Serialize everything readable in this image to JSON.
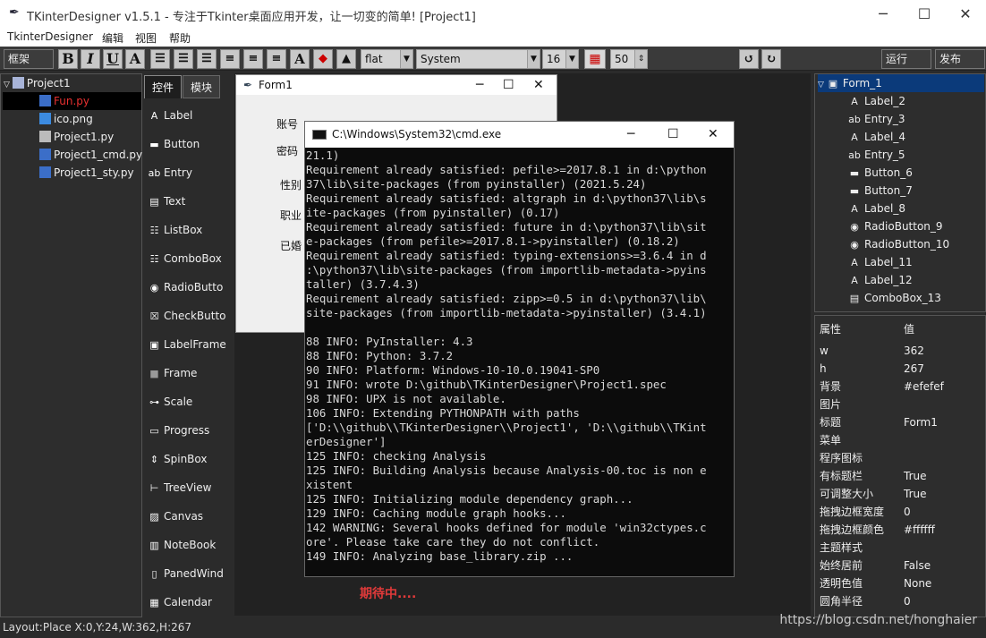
{
  "window": {
    "title": "TKinterDesigner v1.5.1 - 专注于Tkinter桌面应用开发，让一切变的简单!   [Project1]"
  },
  "menu": [
    "TkinterDesigner",
    "编辑",
    "视图",
    "帮助"
  ],
  "toolbar": {
    "frame_label": "框架",
    "bold": "B",
    "italic": "I",
    "underline": "U",
    "font_a": "A",
    "relief": "flat",
    "font_family": "System",
    "font_size": "16",
    "alpha": "50",
    "run": "运行",
    "publish": "发布"
  },
  "project": {
    "root": "Project1",
    "files": [
      "Fun.py",
      "ico.png",
      "Project1.py",
      "Project1_cmd.py",
      "Project1_sty.py"
    ]
  },
  "tabs": [
    "控件",
    "模块"
  ],
  "controls": [
    "Label",
    "Button",
    "Entry",
    "Text",
    "ListBox",
    "ComboBox",
    "RadioButto",
    "CheckButto",
    "LabelFrame",
    "Frame",
    "Scale",
    "Progress",
    "SpinBox",
    "TreeView",
    "Canvas",
    "NoteBook",
    "PanedWind",
    "Calendar"
  ],
  "form": {
    "title": "Form1",
    "labels": [
      "账号",
      "密码",
      "性别",
      "职业",
      "已婚"
    ]
  },
  "cmd": {
    "title": "C:\\Windows\\System32\\cmd.exe",
    "lines": [
      "21.1)",
      "Requirement already satisfied: pefile>=2017.8.1 in d:\\python",
      "37\\lib\\site-packages (from pyinstaller) (2021.5.24)",
      "Requirement already satisfied: altgraph in d:\\python37\\lib\\s",
      "ite-packages (from pyinstaller) (0.17)",
      "Requirement already satisfied: future in d:\\python37\\lib\\sit",
      "e-packages (from pefile>=2017.8.1->pyinstaller) (0.18.2)",
      "Requirement already satisfied: typing-extensions>=3.6.4 in d",
      ":\\python37\\lib\\site-packages (from importlib-metadata->pyins",
      "taller) (3.7.4.3)",
      "Requirement already satisfied: zipp>=0.5 in d:\\python37\\lib\\",
      "site-packages (from importlib-metadata->pyinstaller) (3.4.1)",
      "",
      "88 INFO: PyInstaller: 4.3",
      "88 INFO: Python: 3.7.2",
      "90 INFO: Platform: Windows-10-10.0.19041-SP0",
      "91 INFO: wrote D:\\github\\TKinterDesigner\\Project1.spec",
      "98 INFO: UPX is not available.",
      "106 INFO: Extending PYTHONPATH with paths",
      "['D:\\\\github\\\\TKinterDesigner\\\\Project1', 'D:\\\\github\\\\TKint",
      "erDesigner']",
      "125 INFO: checking Analysis",
      "125 INFO: Building Analysis because Analysis-00.toc is non e",
      "xistent",
      "125 INFO: Initializing module dependency graph...",
      "129 INFO: Caching module graph hooks...",
      "142 WARNING: Several hooks defined for module 'win32ctypes.c",
      "ore'. Please take care they do not conflict.",
      "149 INFO: Analyzing base_library.zip ...",
      "",
      "▬"
    ]
  },
  "pending": "期待中....",
  "tree": {
    "root": "Form_1",
    "items": [
      {
        "icon": "A",
        "label": "Label_2"
      },
      {
        "icon": "ab",
        "label": "Entry_3"
      },
      {
        "icon": "A",
        "label": "Label_4"
      },
      {
        "icon": "ab",
        "label": "Entry_5"
      },
      {
        "icon": "▬",
        "label": "Button_6"
      },
      {
        "icon": "▬",
        "label": "Button_7"
      },
      {
        "icon": "A",
        "label": "Label_8"
      },
      {
        "icon": "◉",
        "label": "RadioButton_9"
      },
      {
        "icon": "◉",
        "label": "RadioButton_10"
      },
      {
        "icon": "A",
        "label": "Label_11"
      },
      {
        "icon": "A",
        "label": "Label_12"
      },
      {
        "icon": "▤",
        "label": "ComboBox_13"
      }
    ]
  },
  "props": {
    "header": [
      "属性",
      "值"
    ],
    "rows": [
      [
        "w",
        "362"
      ],
      [
        "h",
        "267"
      ],
      [
        "背景",
        "#efefef"
      ],
      [
        "图片",
        ""
      ],
      [
        "标题",
        "Form1"
      ],
      [
        "菜单",
        ""
      ],
      [
        "程序图标",
        ""
      ],
      [
        "有标题栏",
        "True"
      ],
      [
        "可调整大小",
        "True"
      ],
      [
        "拖拽边框宽度",
        "0"
      ],
      [
        "拖拽边框颜色",
        "#ffffff"
      ],
      [
        "主题样式",
        ""
      ],
      [
        "始终居前",
        "False"
      ],
      [
        "透明色值",
        "None"
      ],
      [
        "圆角半径",
        "0"
      ]
    ]
  },
  "status": "Layout:Place  X:0,Y:24,W:362,H:267",
  "watermark": "https://blog.csdn.net/honghaier"
}
